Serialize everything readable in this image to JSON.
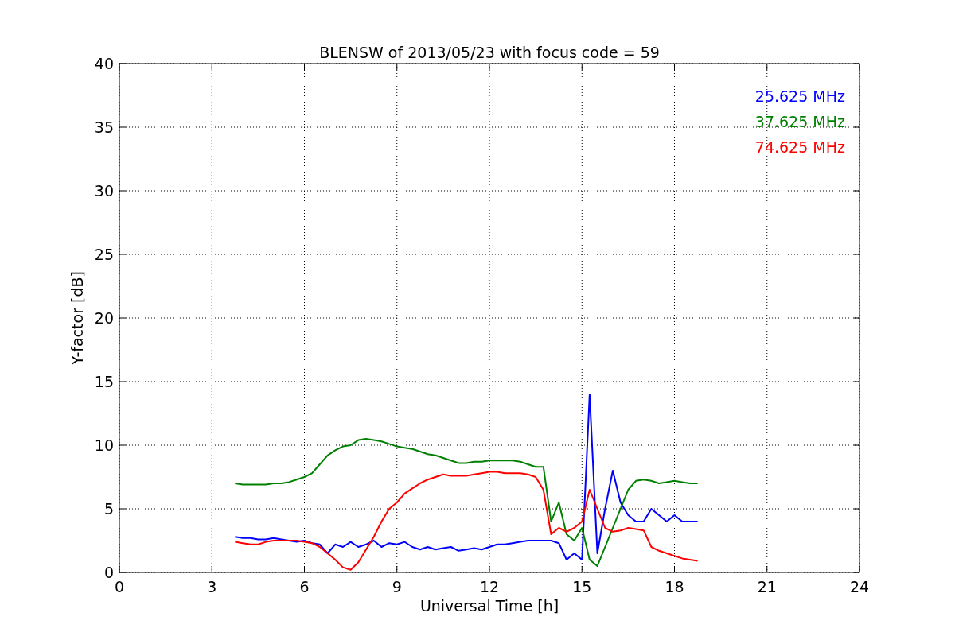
{
  "figure": {
    "chart_data": {
      "type": "line",
      "title": "BLENSW of 2013/05/23 with focus code = 59",
      "xlabel": "Universal Time [h]",
      "ylabel": "Y-factor [dB]",
      "grid": true,
      "xlim": [
        0,
        24
      ],
      "ylim": [
        0,
        40
      ],
      "xticks": [
        0,
        3,
        6,
        9,
        12,
        15,
        18,
        21,
        24
      ],
      "yticks": [
        0,
        5,
        10,
        15,
        20,
        25,
        30,
        35,
        40
      ],
      "x": [
        3.75,
        4,
        4.25,
        4.5,
        4.75,
        5,
        5.25,
        5.5,
        5.75,
        6,
        6.25,
        6.5,
        6.75,
        7,
        7.25,
        7.5,
        7.75,
        8,
        8.25,
        8.5,
        8.75,
        9,
        9.25,
        9.5,
        9.75,
        10,
        10.25,
        10.5,
        10.75,
        11,
        11.25,
        11.5,
        11.75,
        12,
        12.25,
        12.5,
        12.75,
        13,
        13.25,
        13.5,
        13.75,
        14,
        14.25,
        14.5,
        14.75,
        15,
        15.25,
        15.5,
        15.75,
        16,
        16.25,
        16.5,
        16.75,
        17,
        17.25,
        17.5,
        17.75,
        18,
        18.25,
        18.5,
        18.75
      ],
      "series": [
        {
          "name": "25.625 MHz",
          "color": "#0000ff",
          "values": [
            2.8,
            2.7,
            2.7,
            2.6,
            2.6,
            2.7,
            2.6,
            2.5,
            2.4,
            2.5,
            2.3,
            2.2,
            1.5,
            2.2,
            2.0,
            2.4,
            2.0,
            2.2,
            2.5,
            2.0,
            2.3,
            2.2,
            2.4,
            2.0,
            1.8,
            2.0,
            1.8,
            1.9,
            2.0,
            1.7,
            1.8,
            1.9,
            1.8,
            2.0,
            2.2,
            2.2,
            2.3,
            2.4,
            2.5,
            2.5,
            2.5,
            2.5,
            2.3,
            1.0,
            1.5,
            1.0,
            14.0,
            1.5,
            5.0,
            8.0,
            5.5,
            4.5,
            4.0,
            4.0,
            5.0,
            4.5,
            4.0,
            4.5,
            4.0,
            4.0,
            4.0
          ]
        },
        {
          "name": "37.625 MHz",
          "color": "#008000",
          "values": [
            7.0,
            6.9,
            6.9,
            6.9,
            6.9,
            7.0,
            7.0,
            7.1,
            7.3,
            7.5,
            7.8,
            8.5,
            9.2,
            9.6,
            9.9,
            10.0,
            10.4,
            10.5,
            10.4,
            10.3,
            10.1,
            9.9,
            9.8,
            9.7,
            9.5,
            9.3,
            9.2,
            9.0,
            8.8,
            8.6,
            8.6,
            8.7,
            8.7,
            8.8,
            8.8,
            8.8,
            8.8,
            8.7,
            8.5,
            8.3,
            8.3,
            4.0,
            5.5,
            3.0,
            2.5,
            3.5,
            1.0,
            0.5,
            2.0,
            3.5,
            5.0,
            6.5,
            7.2,
            7.3,
            7.2,
            7.0,
            7.1,
            7.2,
            7.1,
            7.0,
            7.0
          ]
        },
        {
          "name": "74.625 MHz",
          "color": "#ff0000",
          "values": [
            2.4,
            2.3,
            2.2,
            2.2,
            2.4,
            2.5,
            2.5,
            2.5,
            2.5,
            2.4,
            2.3,
            2.0,
            1.5,
            1.0,
            0.4,
            0.2,
            0.8,
            1.8,
            2.8,
            4.0,
            5.0,
            5.5,
            6.2,
            6.6,
            7.0,
            7.3,
            7.5,
            7.7,
            7.6,
            7.6,
            7.6,
            7.7,
            7.8,
            7.9,
            7.9,
            7.8,
            7.8,
            7.8,
            7.7,
            7.5,
            6.5,
            3.0,
            3.5,
            3.2,
            3.5,
            4.0,
            6.5,
            5.0,
            3.5,
            3.2,
            3.3,
            3.5,
            3.4,
            3.3,
            2.0,
            1.7,
            1.5,
            1.3,
            1.1,
            1.0,
            0.9
          ]
        }
      ]
    }
  }
}
